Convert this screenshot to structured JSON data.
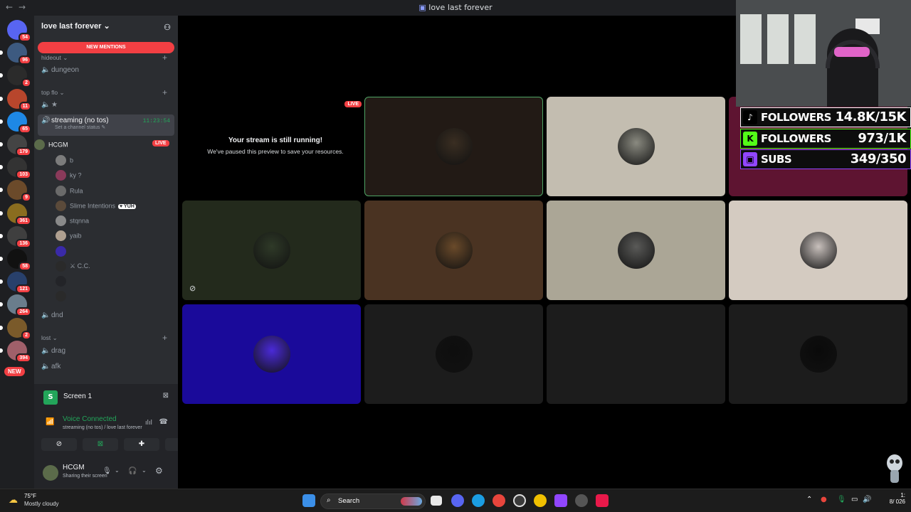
{
  "window": {
    "title": "love last forever",
    "nav_back": "←",
    "nav_fwd": "→"
  },
  "servers": [
    {
      "badge": "54",
      "color": "#5865f2"
    },
    {
      "badge": "96",
      "color": "#3d5a80"
    },
    {
      "badge": "2",
      "color": "#2b2b2b"
    },
    {
      "badge": "11",
      "color": "#b8462c"
    },
    {
      "badge": "65",
      "color": "#1e88e5"
    },
    {
      "badge": "179",
      "color": "#444"
    },
    {
      "badge": "103",
      "color": "#333"
    },
    {
      "badge": "9",
      "color": "#6b4a2a"
    },
    {
      "badge": "361",
      "color": "#8a6d1f"
    },
    {
      "badge": "136",
      "color": "#3f3f3f"
    },
    {
      "badge": "58",
      "color": "#111"
    },
    {
      "badge": "121",
      "color": "#28406b"
    },
    {
      "badge": "264",
      "color": "#6a7d8c"
    },
    {
      "badge": "2",
      "color": "#7a5a2a"
    },
    {
      "badge": "394",
      "color": "#a0606a"
    }
  ],
  "new_button": "NEW",
  "guild": {
    "name": "love last forever",
    "chevron": "⌄"
  },
  "new_mentions": "NEW MENTIONS",
  "categories": {
    "hideout": "hideout ⌄",
    "top_flo": "top flo ⌄",
    "lost": "lost ⌄"
  },
  "channels": {
    "dungeon": "dungeon",
    "star": "★",
    "active": "streaming (no tos)",
    "active_timer": "11:23:54",
    "active_status": "Set a channel status ✎",
    "dnd": "dnd",
    "drag": "drag",
    "afk": "afk"
  },
  "voice_users": [
    {
      "name": "HCGM",
      "badge": "LIVE",
      "color": "#5b6b4a"
    },
    {
      "name": "b",
      "badge": "",
      "color": "#7c7c7c"
    },
    {
      "name": "ky ?",
      "badge": "",
      "color": "#8a3a5a"
    },
    {
      "name": "Rula",
      "badge": "",
      "color": "#6a6a6a"
    },
    {
      "name": "Slime Intentions",
      "badge": "♥ YUH",
      "color": "#5b4a3a"
    },
    {
      "name": "stqnna",
      "badge": "",
      "color": "#8a8a8a"
    },
    {
      "name": "yaib",
      "badge": "",
      "color": "#b0a090"
    },
    {
      "name": "",
      "badge": "",
      "color": "#3a2aa8"
    },
    {
      "name": "⚔ C.C.",
      "badge": "",
      "color": "#2a2a2a"
    },
    {
      "name": "",
      "badge": "",
      "color": "#232428"
    },
    {
      "name": "",
      "badge": "",
      "color": "#2a2a2a"
    }
  ],
  "panel": {
    "screen_label": "Screen 1",
    "voice_title": "Voice Connected",
    "voice_sub": "streaming (no tos) / love last forever",
    "user_name": "HCGM",
    "user_status": "Sharing their screen"
  },
  "stream": {
    "title": "Your stream is still running!",
    "subtitle": "We've paused this preview to save your resources.",
    "live": "LIVE"
  },
  "tiles": [
    {
      "bg": "#221a15",
      "avatar": "#3a2e22",
      "border": "#4fa565"
    },
    {
      "bg": "#c3bdb0",
      "avatar": "#8a8a80",
      "border": ""
    },
    {
      "bg": "#5e1431",
      "avatar": "",
      "border": ""
    },
    {
      "bg": "#232a1c",
      "avatar": "#2f3a28",
      "border": "",
      "muted": true
    },
    {
      "bg": "#4a3322",
      "avatar": "#6a4a2a",
      "border": ""
    },
    {
      "bg": "#aba696",
      "avatar": "#5a5a58",
      "border": ""
    },
    {
      "bg": "#d4cbc1",
      "avatar": "#c8c0bc",
      "border": ""
    },
    {
      "bg": "#1a0a9a",
      "avatar": "#4a2ad8",
      "border": ""
    },
    {
      "bg": "#1c1c1c",
      "avatar": "#0e0e0e",
      "border": ""
    },
    {
      "bg": "#1c1c1c",
      "avatar": "",
      "border": ""
    },
    {
      "bg": "#1c1c1c",
      "avatar": "#0a0a0a",
      "border": ""
    }
  ],
  "overlay": [
    {
      "label": "FOLLOWERS",
      "value": "14.8K/15K",
      "icon": "♪",
      "color": "#ffffff",
      "iconbg": "#000"
    },
    {
      "label": "FOLLOWERS",
      "value": "973/1K",
      "icon": "K",
      "color": "#53fc18",
      "iconbg": "#53fc18"
    },
    {
      "label": "SUBS",
      "value": "349/350",
      "icon": "▣",
      "color": "#9146ff",
      "iconbg": "#9146ff"
    }
  ],
  "taskbar": {
    "temp": "75°F",
    "condition": "Mostly cloudy",
    "search": "Search",
    "time": "1:",
    "date": "8/ 026"
  }
}
